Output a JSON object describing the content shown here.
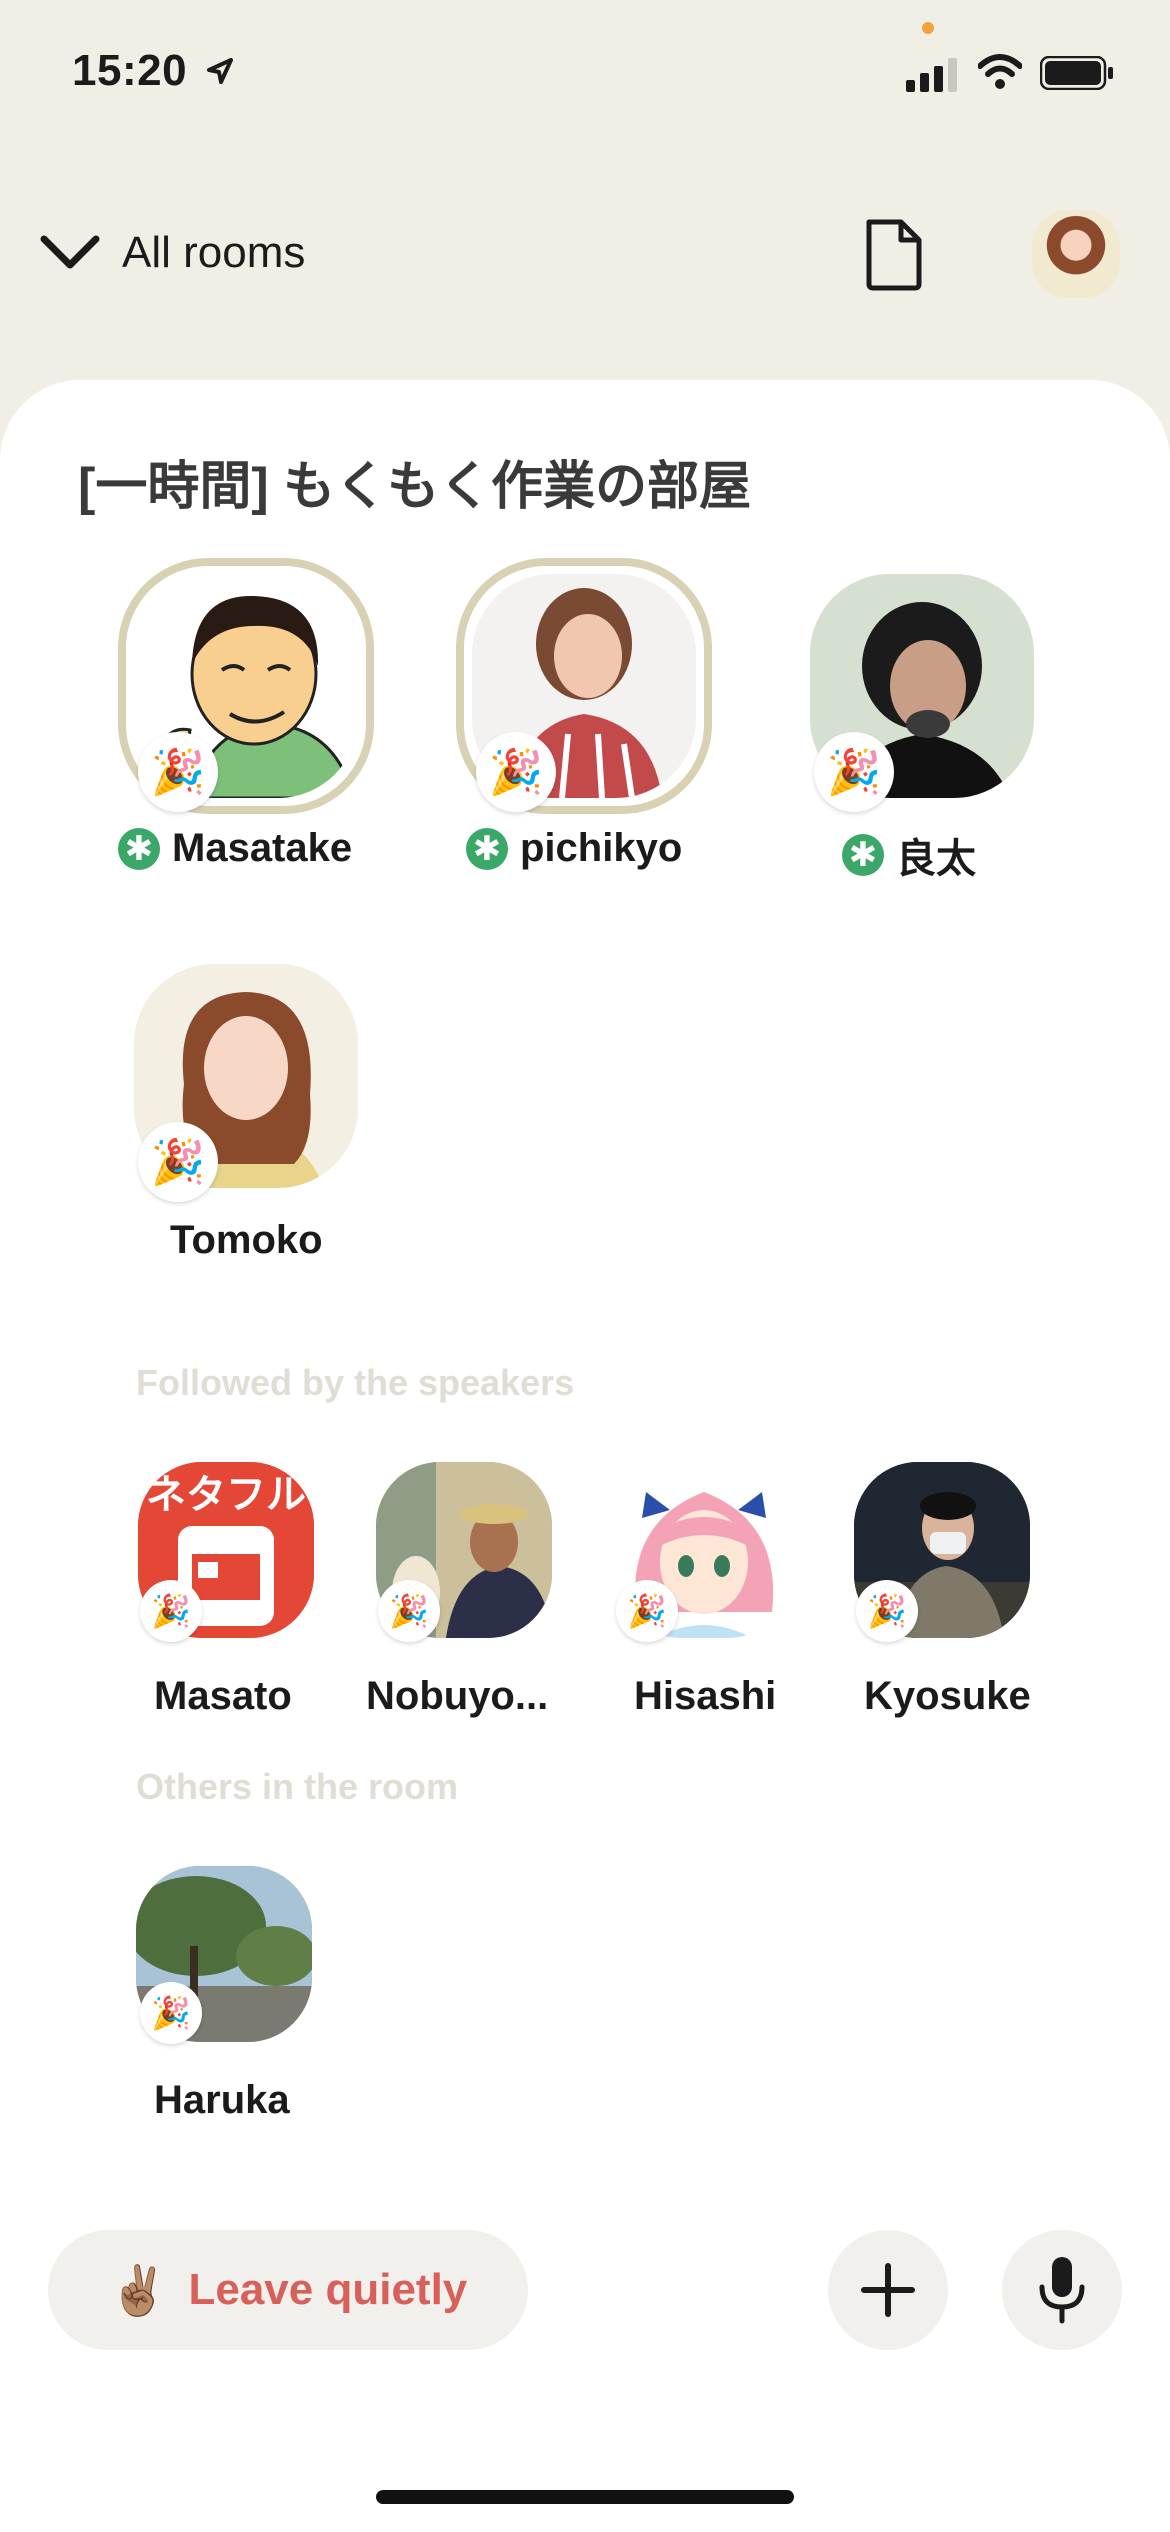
{
  "status_bar": {
    "time": "15:20"
  },
  "nav": {
    "all_rooms_label": "All rooms"
  },
  "room": {
    "title": "[一時間] もくもく作業の部屋"
  },
  "speakers": [
    {
      "name": "Masatake",
      "moderator": true
    },
    {
      "name": "pichikyo",
      "moderator": true
    },
    {
      "name": "良太",
      "moderator": true
    },
    {
      "name": "Tomoko",
      "moderator": false
    }
  ],
  "followed_label": "Followed by the speakers",
  "followed": [
    {
      "name": "Masato"
    },
    {
      "name": "Nobuyo..."
    },
    {
      "name": "Hisashi"
    },
    {
      "name": "Kyosuke"
    }
  ],
  "others_label": "Others in the room",
  "others": [
    {
      "name": "Haruka"
    }
  ],
  "actions": {
    "leave_label": "Leave quietly",
    "leave_emoji": "✌🏽",
    "add_icon": "plus-icon",
    "mic_icon": "microphone-icon"
  },
  "badge_emoji": "🎉",
  "moderator_symbol": "✱",
  "colors": {
    "accent_red": "#d7605a",
    "moderator_green": "#3ba86a",
    "background": "#f1efe5"
  }
}
